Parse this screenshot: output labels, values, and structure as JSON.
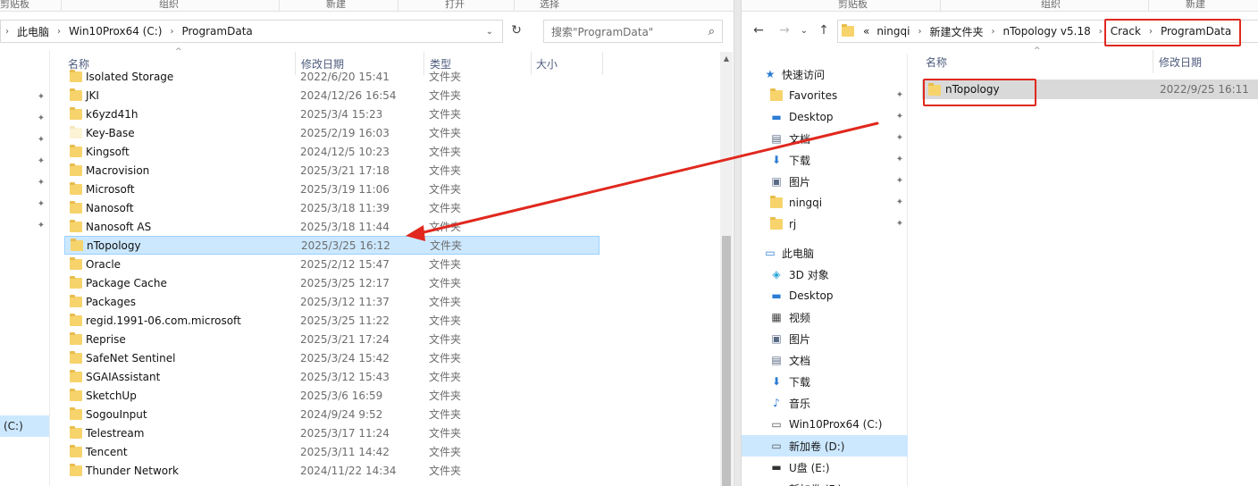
{
  "left": {
    "ribbon": [
      "剪贴板",
      "组织",
      "新建",
      "打开",
      "选择"
    ],
    "address": [
      "此电脑",
      "Win10Prox64 (C:)",
      "ProgramData"
    ],
    "search_placeholder": "搜索\"ProgramData\"",
    "columns": {
      "name": "名称",
      "date": "修改日期",
      "type": "类型",
      "size": "大小"
    },
    "rows": [
      {
        "name": "Isolated Storage",
        "date": "2022/6/20 15:41",
        "type": "文件夹"
      },
      {
        "name": "JKI",
        "date": "2024/12/26 16:54",
        "type": "文件夹"
      },
      {
        "name": "k6yzd41h",
        "date": "2025/3/4 15:23",
        "type": "文件夹"
      },
      {
        "name": "Key-Base",
        "date": "2025/2/19 16:03",
        "type": "文件夹"
      },
      {
        "name": "Kingsoft",
        "date": "2024/12/5 10:23",
        "type": "文件夹"
      },
      {
        "name": "Macrovision",
        "date": "2025/3/21 17:18",
        "type": "文件夹"
      },
      {
        "name": "Microsoft",
        "date": "2025/3/19 11:06",
        "type": "文件夹"
      },
      {
        "name": "Nanosoft",
        "date": "2025/3/18 11:39",
        "type": "文件夹"
      },
      {
        "name": "Nanosoft AS",
        "date": "2025/3/18 11:44",
        "type": "文件夹"
      },
      {
        "name": "nTopology",
        "date": "2025/3/25 16:12",
        "type": "文件夹"
      },
      {
        "name": "Oracle",
        "date": "2025/2/12 15:47",
        "type": "文件夹"
      },
      {
        "name": "Package Cache",
        "date": "2025/3/25 12:17",
        "type": "文件夹"
      },
      {
        "name": "Packages",
        "date": "2025/3/12 11:37",
        "type": "文件夹"
      },
      {
        "name": "regid.1991-06.com.microsoft",
        "date": "2025/3/25 11:22",
        "type": "文件夹"
      },
      {
        "name": "Reprise",
        "date": "2025/3/21 17:24",
        "type": "文件夹"
      },
      {
        "name": "SafeNet Sentinel",
        "date": "2025/3/24 15:42",
        "type": "文件夹"
      },
      {
        "name": "SGAIAssistant",
        "date": "2025/3/12 15:43",
        "type": "文件夹"
      },
      {
        "name": "SketchUp",
        "date": "2025/3/6 16:59",
        "type": "文件夹"
      },
      {
        "name": "SogouInput",
        "date": "2024/9/24 9:52",
        "type": "文件夹"
      },
      {
        "name": "Telestream",
        "date": "2025/3/17 11:24",
        "type": "文件夹"
      },
      {
        "name": "Tencent",
        "date": "2025/3/11 14:42",
        "type": "文件夹"
      },
      {
        "name": "Thunder Network",
        "date": "2024/11/22 14:34",
        "type": "文件夹"
      }
    ],
    "drive_c_label": "(C:)"
  },
  "right": {
    "ribbon": [
      "剪贴板",
      "组织",
      "新建"
    ],
    "address": [
      "«",
      "ningqi",
      "新建文件夹",
      "nTopology v5.18",
      "Crack",
      "ProgramData"
    ],
    "columns": {
      "name": "名称",
      "date": "修改日期"
    },
    "rows": [
      {
        "name": "nTopology",
        "date": "2022/9/25 16:11"
      }
    ],
    "nav": {
      "quick_access": "快速访问",
      "quick_items": [
        {
          "label": "Favorites",
          "icon": "folder-icon"
        },
        {
          "label": "Desktop",
          "icon": "desktop-icon"
        },
        {
          "label": "文档",
          "icon": "document-icon"
        },
        {
          "label": "下载",
          "icon": "download-icon"
        },
        {
          "label": "图片",
          "icon": "picture-icon"
        },
        {
          "label": "ningqi",
          "icon": "folder-icon"
        },
        {
          "label": "rj",
          "icon": "folder-icon"
        }
      ],
      "this_pc": "此电脑",
      "pc_items": [
        {
          "label": "3D 对象",
          "icon": "3d-objects-icon"
        },
        {
          "label": "Desktop",
          "icon": "desktop-icon"
        },
        {
          "label": "视频",
          "icon": "video-icon"
        },
        {
          "label": "图片",
          "icon": "picture-icon"
        },
        {
          "label": "文档",
          "icon": "document-icon"
        },
        {
          "label": "下载",
          "icon": "download-icon"
        },
        {
          "label": "音乐",
          "icon": "music-icon"
        },
        {
          "label": "Win10Prox64 (C:)",
          "icon": "drive-icon"
        },
        {
          "label": "新加卷 (D:)",
          "icon": "drive-icon"
        },
        {
          "label": "U盘 (E:)",
          "icon": "usb-drive-icon"
        },
        {
          "label": "新加卷 (F:)",
          "icon": "drive-icon"
        }
      ]
    }
  },
  "colors": {
    "selection": "#cce8ff",
    "selection_border": "#99d1ff",
    "annotation": "#e0281e",
    "folder": "#f7d36b"
  }
}
